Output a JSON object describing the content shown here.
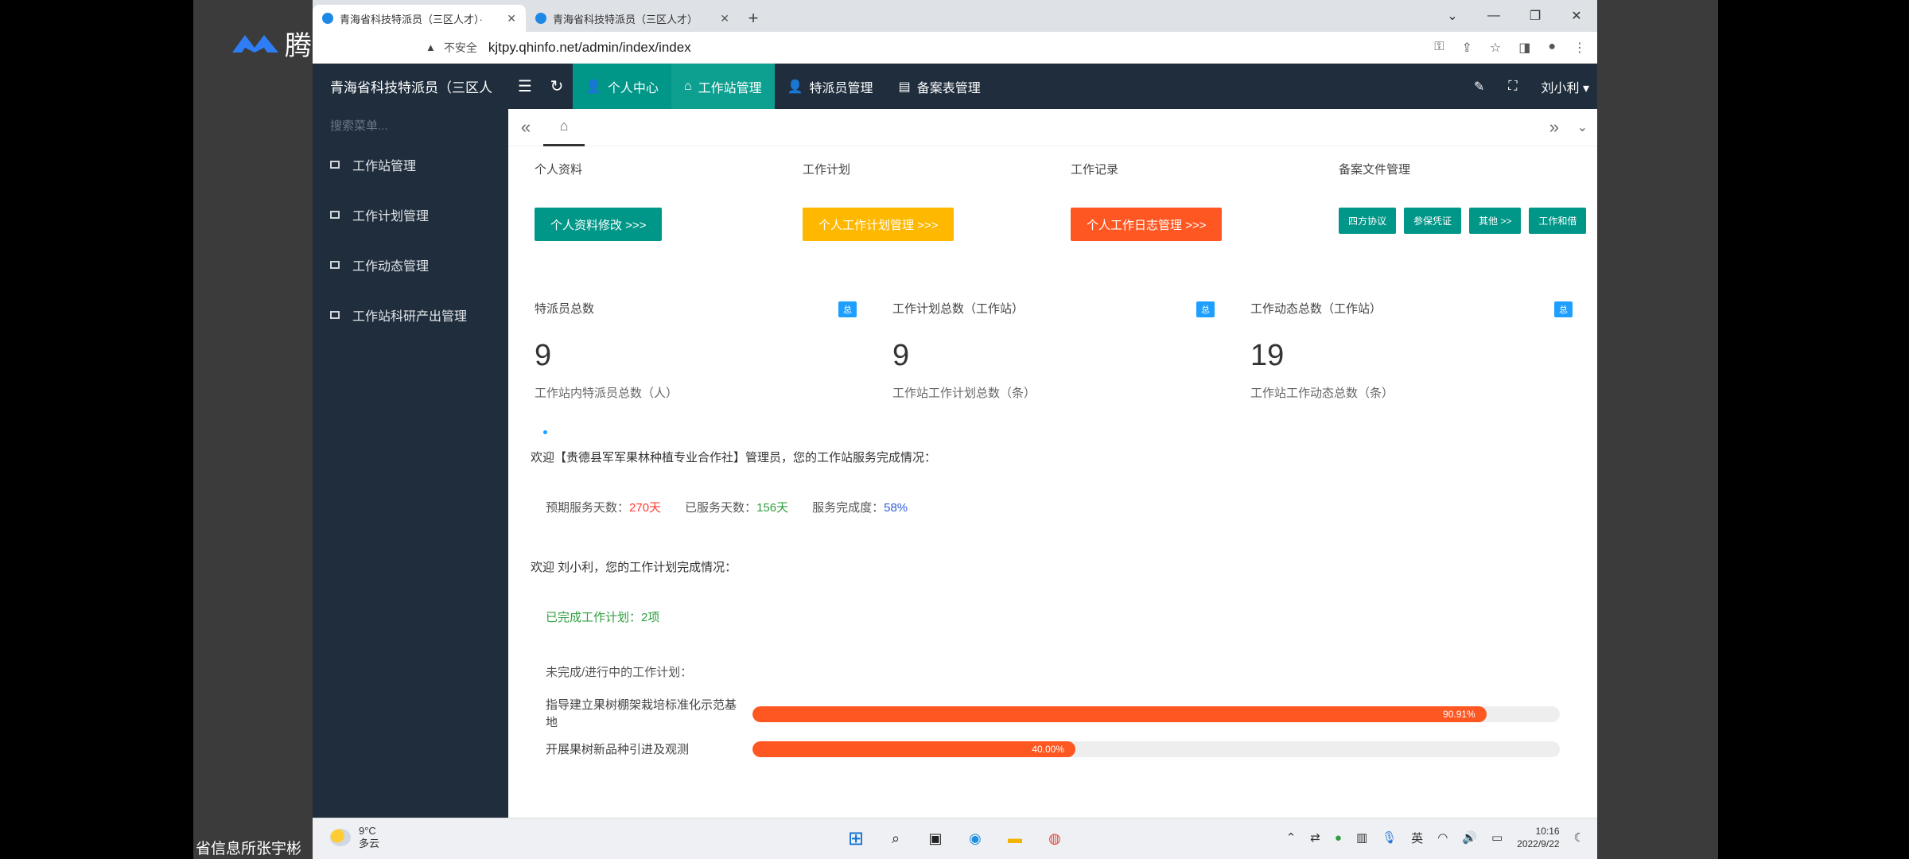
{
  "overlay": {
    "brand": "腾讯会议",
    "caption": "省信息所张宇彬"
  },
  "browser": {
    "tabs": [
      {
        "title": "青海省科技特派员（三区人才）·",
        "active": true
      },
      {
        "title": "青海省科技特派员（三区人才）",
        "active": false
      }
    ],
    "new_tab": "+",
    "security_label": "不安全",
    "url": "kjtpy.qhinfo.net/admin/index/index",
    "win_controls": [
      "⌄",
      "—",
      "❐",
      "✕"
    ]
  },
  "app": {
    "title": "青海省科技特派员（三区人",
    "nav": [
      {
        "icon": "user-icon",
        "label": "个人中心"
      },
      {
        "icon": "home-icon",
        "label": "工作站管理"
      },
      {
        "icon": "user-icon",
        "label": "特派员管理"
      },
      {
        "icon": "doc-icon",
        "label": "备案表管理"
      }
    ],
    "user": "刘小利"
  },
  "sidebar": {
    "search_placeholder": "搜索菜单...",
    "items": [
      {
        "label": "工作站管理"
      },
      {
        "label": "工作计划管理"
      },
      {
        "label": "工作动态管理"
      },
      {
        "label": "工作站科研产出管理"
      }
    ]
  },
  "quick": {
    "profile": {
      "label": "个人资料",
      "button": "个人资料修改 >>>"
    },
    "plan": {
      "label": "工作计划",
      "button": "个人工作计划管理 >>>"
    },
    "record": {
      "label": "工作记录",
      "button": "个人工作日志管理 >>>"
    },
    "files": {
      "label": "备案文件管理",
      "buttons": [
        "四方协议",
        "参保凭证",
        "其他 >>",
        "工作和借"
      ]
    }
  },
  "stats": [
    {
      "label": "特派员总数",
      "badge": "总",
      "value": "9",
      "desc": "工作站内特派员总数（人）"
    },
    {
      "label": "工作计划总数（工作站）",
      "badge": "总",
      "value": "9",
      "desc": "工作站工作计划总数（条）"
    },
    {
      "label": "工作动态总数（工作站）",
      "badge": "总",
      "value": "19",
      "desc": "工作站工作动态总数（条）"
    }
  ],
  "service": {
    "welcome": "欢迎【贵德县军军果林种植专业合作社】管理员，您的工作站服务完成情况：",
    "planned_label": "预期服务天数：",
    "planned_value": "270天",
    "served_label": "已服务天数：",
    "served_value": "156天",
    "rate_label": "服务完成度：",
    "rate_value": "58%"
  },
  "plans": {
    "welcome": "欢迎 刘小利，您的工作计划完成情况：",
    "done": "已完成工作计划：2项",
    "undone_title": "未完成/进行中的工作计划：",
    "items": [
      {
        "name": "指导建立果树棚架栽培标准化示范基地",
        "progress": 90.91,
        "progress_label": "90.91%"
      },
      {
        "name": "开展果树新品种引进及观测",
        "progress": 40.0,
        "progress_label": "40.00%"
      }
    ]
  },
  "taskbar": {
    "temp": "9°C",
    "weather": "多云",
    "ime": "英",
    "time": "10:16",
    "date": "2022/9/22"
  },
  "colors": {
    "header": "#1f2d3d",
    "accent": "#009688",
    "yellow": "#ffb800",
    "orange": "#ff5722",
    "badge": "#1e9fff"
  }
}
